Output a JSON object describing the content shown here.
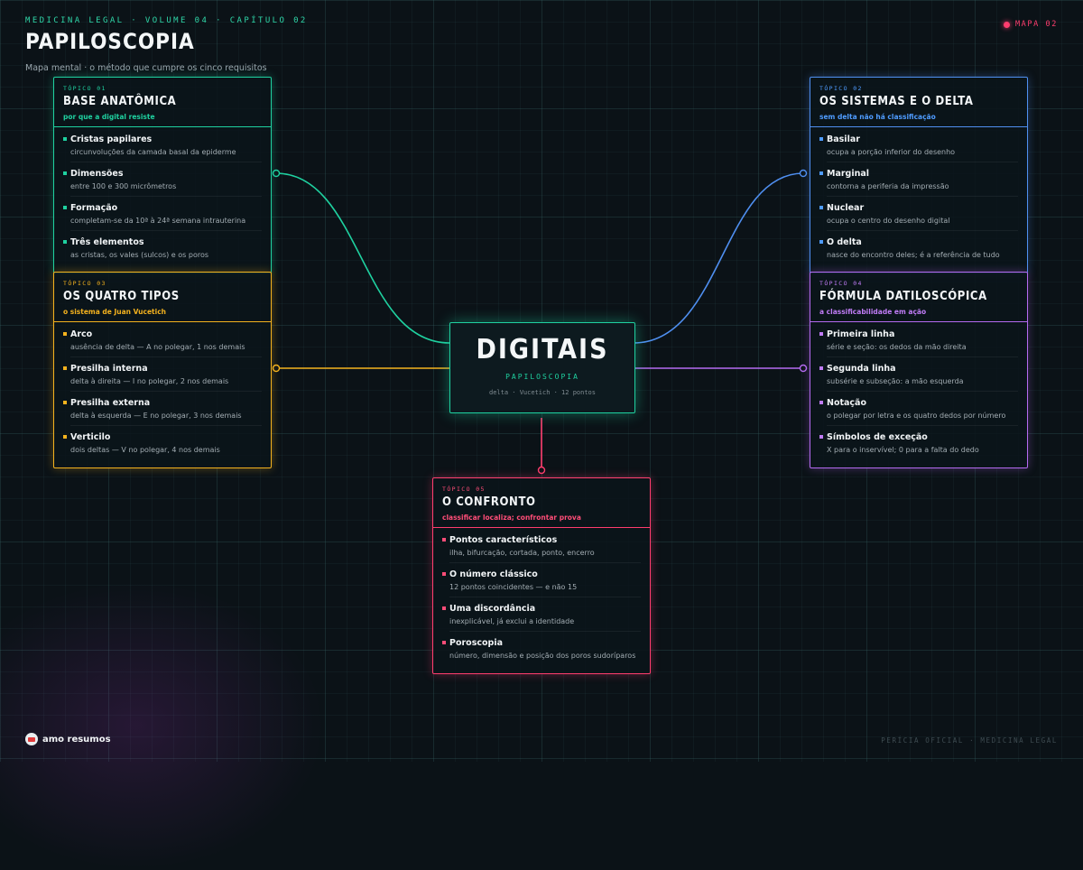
{
  "header": {
    "kicker": "MEDICINA LEGAL · VOLUME 04 · CAPÍTULO 02",
    "title": "PAPILOSCOPIA",
    "subtitle": "Mapa mental · o método que cumpre os cinco requisitos",
    "map_badge": "MAPA 02"
  },
  "center": {
    "title": "DIGITAIS",
    "subtitle": "PAPILOSCOPIA",
    "meta": "delta · Vucetich · 12 pontos"
  },
  "topics": [
    {
      "tag": "TÓPICO 01",
      "title": "BASE ANATÔMICA",
      "subtitle": "por que a digital resiste",
      "items": [
        {
          "title": "Cristas papilares",
          "desc": "circunvoluções da camada basal da epiderme"
        },
        {
          "title": "Dimensões",
          "desc": "entre 100 e 300 micrômetros"
        },
        {
          "title": "Formação",
          "desc": "completam-se da 10ª à 24ª semana intrauterina"
        },
        {
          "title": "Três elementos",
          "desc": "as cristas, os vales (sulcos) e os poros"
        }
      ]
    },
    {
      "tag": "TÓPICO 02",
      "title": "OS SISTEMAS E O DELTA",
      "subtitle": "sem delta não há classificação",
      "items": [
        {
          "title": "Basilar",
          "desc": "ocupa a porção inferior do desenho"
        },
        {
          "title": "Marginal",
          "desc": "contorna a periferia da impressão"
        },
        {
          "title": "Nuclear",
          "desc": "ocupa o centro do desenho digital"
        },
        {
          "title": "O delta",
          "desc": "nasce do encontro deles; é a referência de tudo"
        }
      ]
    },
    {
      "tag": "TÓPICO 03",
      "title": "OS QUATRO TIPOS",
      "subtitle": "o sistema de Juan Vucetich",
      "items": [
        {
          "title": "Arco",
          "desc": "ausência de delta — A no polegar, 1 nos demais"
        },
        {
          "title": "Presilha interna",
          "desc": "delta à direita — I no polegar, 2 nos demais"
        },
        {
          "title": "Presilha externa",
          "desc": "delta à esquerda — E no polegar, 3 nos demais"
        },
        {
          "title": "Verticilo",
          "desc": "dois deltas — V no polegar, 4 nos demais"
        }
      ]
    },
    {
      "tag": "TÓPICO 04",
      "title": "FÓRMULA DATILOSCÓPICA",
      "subtitle": "a classificabilidade em ação",
      "items": [
        {
          "title": "Primeira linha",
          "desc": "série e seção: os dedos da mão direita"
        },
        {
          "title": "Segunda linha",
          "desc": "subsérie e subseção: a mão esquerda"
        },
        {
          "title": "Notação",
          "desc": "o polegar por letra e os quatro dedos por número"
        },
        {
          "title": "Símbolos de exceção",
          "desc": "X para o inservível; 0 para a falta do dedo"
        }
      ]
    },
    {
      "tag": "TÓPICO 05",
      "title": "O CONFRONTO",
      "subtitle": "classificar localiza; confrontar prova",
      "items": [
        {
          "title": "Pontos característicos",
          "desc": "ilha, bifurcação, cortada, ponto, encerro"
        },
        {
          "title": "O número clássico",
          "desc": "12 pontos coincidentes — e não 15"
        },
        {
          "title": "Uma discordância",
          "desc": "inexplicável, já exclui a identidade"
        },
        {
          "title": "Poroscopia",
          "desc": "número, dimensão e posição dos poros sudoríparos"
        }
      ]
    }
  ],
  "footer": {
    "logo_text": "amo resumos",
    "right": "PERÍCIA OFICIAL · MEDICINA LEGAL"
  },
  "colors": {
    "topic_01": "#1fd1a0",
    "topic_02": "#4f8ff0",
    "topic_03": "#f4b21e",
    "topic_04": "#b46af0",
    "topic_05": "#ff3d6e",
    "background": "#0b1217"
  }
}
